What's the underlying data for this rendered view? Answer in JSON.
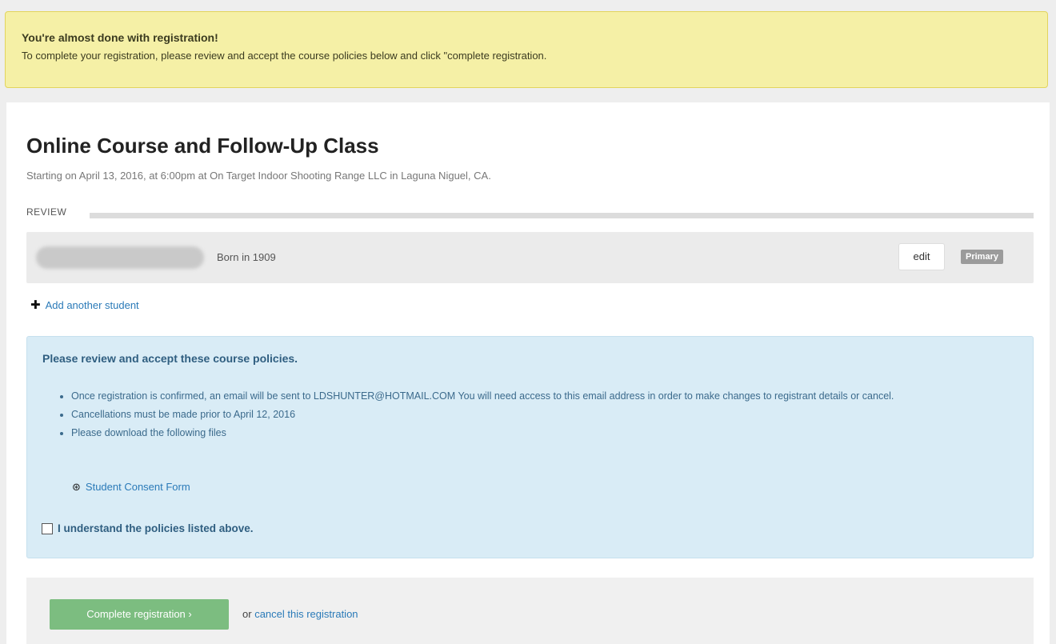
{
  "alert": {
    "title": "You're almost done with registration!",
    "message": "To complete your registration, please review and accept the course policies below and click \"complete registration."
  },
  "course": {
    "title": "Online Course and Follow-Up Class",
    "subtitle": "Starting on April 13, 2016, at 6:00pm at On Target Indoor Shooting Range LLC in Laguna Niguel, CA."
  },
  "review": {
    "section_label": "REVIEW",
    "student": {
      "born": "Born in 1909",
      "edit_label": "edit",
      "badge": "Primary"
    },
    "add_student_label": "Add another student"
  },
  "policies": {
    "title": "Please review and accept these course policies.",
    "items": [
      "Once registration is confirmed, an email will be sent to LDSHUNTER@HOTMAIL.COM You will need access to this email address in order to make changes to registrant details or cancel.",
      "Cancellations must be made prior to April 12, 2016",
      "Please download the following files"
    ],
    "file_link": "Student Consent Form",
    "accept_label": "I understand the policies listed above."
  },
  "footer": {
    "complete_label": "Complete registration",
    "cancel_prefix": "or",
    "cancel_link": "cancel this registration"
  },
  "colors": {
    "alert_bg": "#f5f0a6",
    "info_bg": "#d9ecf6",
    "success_button": "#7cbd80",
    "link": "#2a7ab8"
  }
}
